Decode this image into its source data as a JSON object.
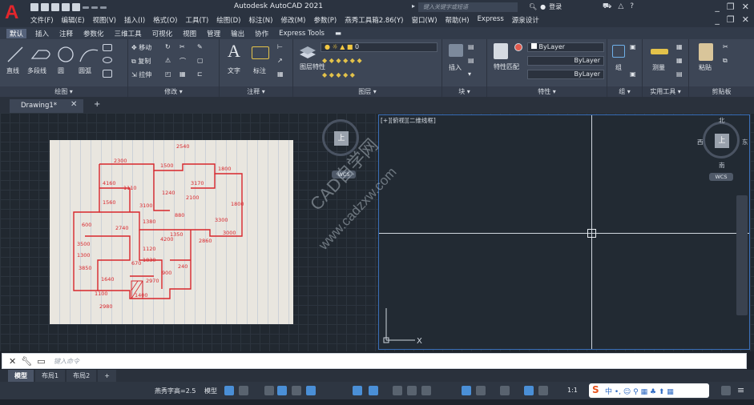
{
  "app": {
    "title": "Autodesk AutoCAD 2021",
    "search_placeholder": "键入关键字或短语",
    "login": "登录"
  },
  "menubar": [
    "文件(F)",
    "编辑(E)",
    "视图(V)",
    "插入(I)",
    "格式(O)",
    "工具(T)",
    "绘图(D)",
    "标注(N)",
    "修改(M)",
    "参数(P)",
    "燕秀工具箱2.86(Y)",
    "窗口(W)",
    "帮助(H)",
    "Express",
    "源泉设计"
  ],
  "ribbon_tabs": [
    "默认",
    "插入",
    "注释",
    "参数化",
    "三维工具",
    "可视化",
    "视图",
    "管理",
    "输出",
    "协作",
    "Express Tools"
  ],
  "ribbon_active_tab": "默认",
  "panels": {
    "draw": {
      "title": "绘图 ▾",
      "tools": [
        "直线",
        "多段线",
        "圆",
        "圆弧"
      ]
    },
    "modify": {
      "title": "修改 ▾",
      "tools": [
        "移动",
        "复制",
        "拉伸"
      ]
    },
    "annotation": {
      "title": "注释 ▾",
      "tools": [
        "文字",
        "标注"
      ]
    },
    "layers": {
      "title": "图层 ▾",
      "tools": [
        "图层特性"
      ],
      "current_layer": "0"
    },
    "block": {
      "title": "块 ▾",
      "tools": [
        "插入"
      ]
    },
    "properties": {
      "title": "特性 ▾",
      "tools": [
        "特性匹配"
      ],
      "color": "ByLayer",
      "linetype": "ByLayer",
      "lineweight": "ByLayer"
    },
    "groups": {
      "title": "组 ▾",
      "tools": [
        "组"
      ]
    },
    "utilities": {
      "title": "实用工具 ▾",
      "tools": [
        "测量"
      ]
    },
    "clipboard": {
      "title": "剪贴板",
      "tools": [
        "粘贴"
      ]
    }
  },
  "document_tab": "Drawing1*",
  "viewport_label": "[+][俯视][二维线框]",
  "viewcube": {
    "north": "北",
    "south": "南",
    "east": "东",
    "west": "西",
    "face": "上",
    "wcs": "WCS"
  },
  "watermark": {
    "line1": "CAD自学网",
    "line2": "www.cadzxw.com"
  },
  "command_line": {
    "placeholder": "键入命令"
  },
  "layout_tabs": [
    "模型",
    "布局1",
    "布局2"
  ],
  "layout_active": "模型",
  "statusbar": {
    "scale": "燕秀字高=2.5",
    "model": "模型",
    "annotation_scale": "1:1"
  },
  "sketch_dimensions": [
    "2540",
    "2300",
    "1500",
    "1800",
    "4160",
    "1110",
    "3170",
    "1560",
    "3100",
    "1800",
    "3500",
    "1240",
    "880",
    "2100",
    "600",
    "4200",
    "3300",
    "2860",
    "670",
    "1120",
    "3850",
    "1350",
    "1380",
    "2740",
    "240",
    "1640",
    "2970",
    "1300",
    "1100",
    "1400",
    "900",
    "2980",
    "1830",
    "3000"
  ],
  "colors": {
    "accent": "#3a6fb8",
    "sketch_ink": "#d8262c",
    "logo": "#e3262c"
  }
}
